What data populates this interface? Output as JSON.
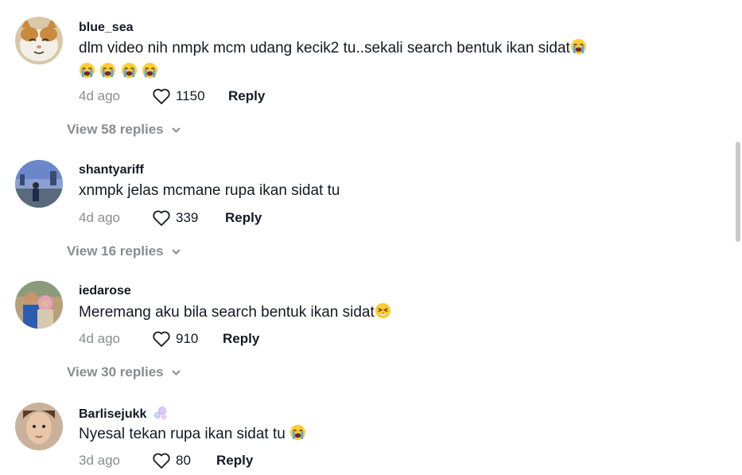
{
  "comments": [
    {
      "username": "blue_sea",
      "text": "dlm video nih nmpk mcm udang kecik2 tu..sekali search bentuk ikan sidat",
      "time": "4d ago",
      "likes": "1150",
      "reply_label": "Reply",
      "view_replies": "View 58 replies"
    },
    {
      "username": "shantyariff",
      "text": "xnmpk jelas mcmane rupa ikan sidat tu",
      "time": "4d ago",
      "likes": "339",
      "reply_label": "Reply",
      "view_replies": "View 16 replies"
    },
    {
      "username": "iedarose",
      "text": "Meremang aku bila search bentuk ikan sidat",
      "time": "4d ago",
      "likes": "910",
      "reply_label": "Reply",
      "view_replies": "View 30 replies"
    },
    {
      "username": "Barlisejukk",
      "text": "Nyesal tekan rupa ikan sidat tu",
      "time": "3d ago",
      "likes": "80",
      "reply_label": "Reply"
    }
  ],
  "icons": {
    "crying": "loudly-crying-face-icon",
    "tired": "tired-face-icon",
    "bubbles": "bubbles-icon",
    "heart": "heart-outline-icon",
    "chevron": "chevron-down-icon"
  },
  "colors": {
    "text": "#161823",
    "muted": "#8a8b91",
    "emoji_face": "#ffcc33",
    "emoji_tears": "#4aa8ff"
  }
}
